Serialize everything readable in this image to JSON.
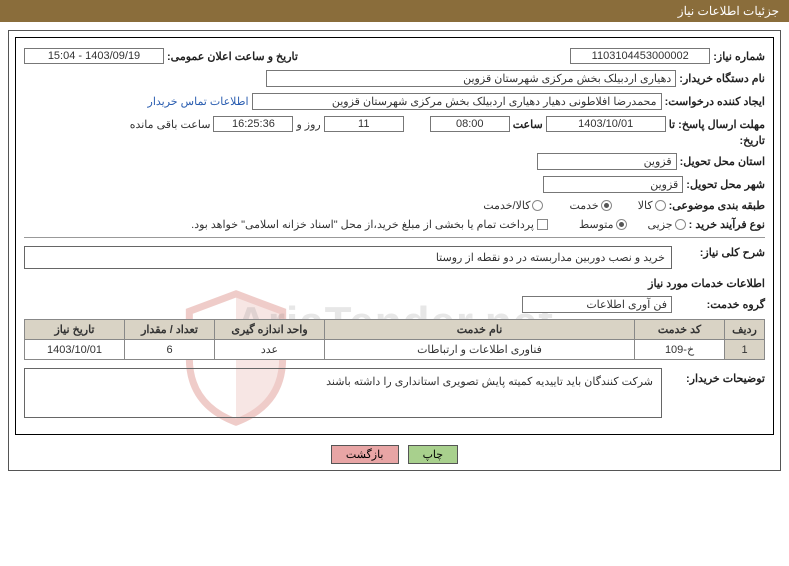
{
  "header": {
    "title": "جزئیات اطلاعات نیاز"
  },
  "fields": {
    "need_no_label": "شماره نیاز:",
    "need_no": "1103104453000002",
    "announce_label": "تاریخ و ساعت اعلان عمومی:",
    "announce_value": "1403/09/19 - 15:04",
    "buyer_org_label": "نام دستگاه خریدار:",
    "buyer_org": "دهیاری اردبیلک بخش مرکزی شهرستان قزوین",
    "requester_label": "ایجاد کننده درخواست:",
    "requester": "محمدرضا افلاطونی دهیار دهیاری اردبیلک بخش مرکزی شهرستان قزوین",
    "contact_link": "اطلاعات تماس خریدار",
    "deadline_label_1": "مهلت ارسال پاسخ: تا",
    "deadline_label_2": "تاریخ:",
    "deadline_date": "1403/10/01",
    "deadline_time_label": "ساعت",
    "deadline_time": "08:00",
    "days_remaining": "11",
    "days_remaining_label": "روز و",
    "time_remaining": "16:25:36",
    "time_remaining_label": "ساعت باقی مانده",
    "delivery_province_label": "استان محل تحویل:",
    "delivery_province": "قزوین",
    "delivery_city_label": "شهر محل تحویل:",
    "delivery_city": "قزوین",
    "category_label": "طبقه بندی موضوعی:",
    "cat_opt_goods": "کالا",
    "cat_opt_service": "خدمت",
    "cat_opt_both": "کالا/خدمت",
    "process_label": "نوع فرآیند خرید :",
    "proc_opt_partial": "جزیی",
    "proc_opt_mid": "متوسط",
    "payment_note": "پرداخت تمام یا بخشی از مبلغ خرید،از محل \"اسناد خزانه اسلامی\" خواهد بود.",
    "general_desc_label": "شرح کلی نیاز:",
    "general_desc": "خرید و نصب دوربین مداربسته در دو نقطه از روستا",
    "services_info_label": "اطلاعات خدمات مورد نیاز",
    "service_group_label": "گروه خدمت:",
    "service_group": "فن آوری اطلاعات",
    "buyer_notes_label": "توضیحات خریدار:",
    "buyer_notes": "شرکت کنندگان باید تاییدیه کمیته پایش تصویری استانداری را داشته باشند"
  },
  "table": {
    "headers": {
      "row": "ردیف",
      "code": "کد خدمت",
      "name": "نام خدمت",
      "unit": "واحد اندازه گیری",
      "qty": "تعداد / مقدار",
      "date": "تاریخ نیاز"
    },
    "rows": [
      {
        "row": "1",
        "code": "خ-109",
        "name": "فناوری اطلاعات و ارتباطات",
        "unit": "عدد",
        "qty": "6",
        "date": "1403/10/01"
      }
    ]
  },
  "buttons": {
    "print": "چاپ",
    "back": "بازگشت"
  },
  "watermark": {
    "text": "AriaTender.net"
  }
}
